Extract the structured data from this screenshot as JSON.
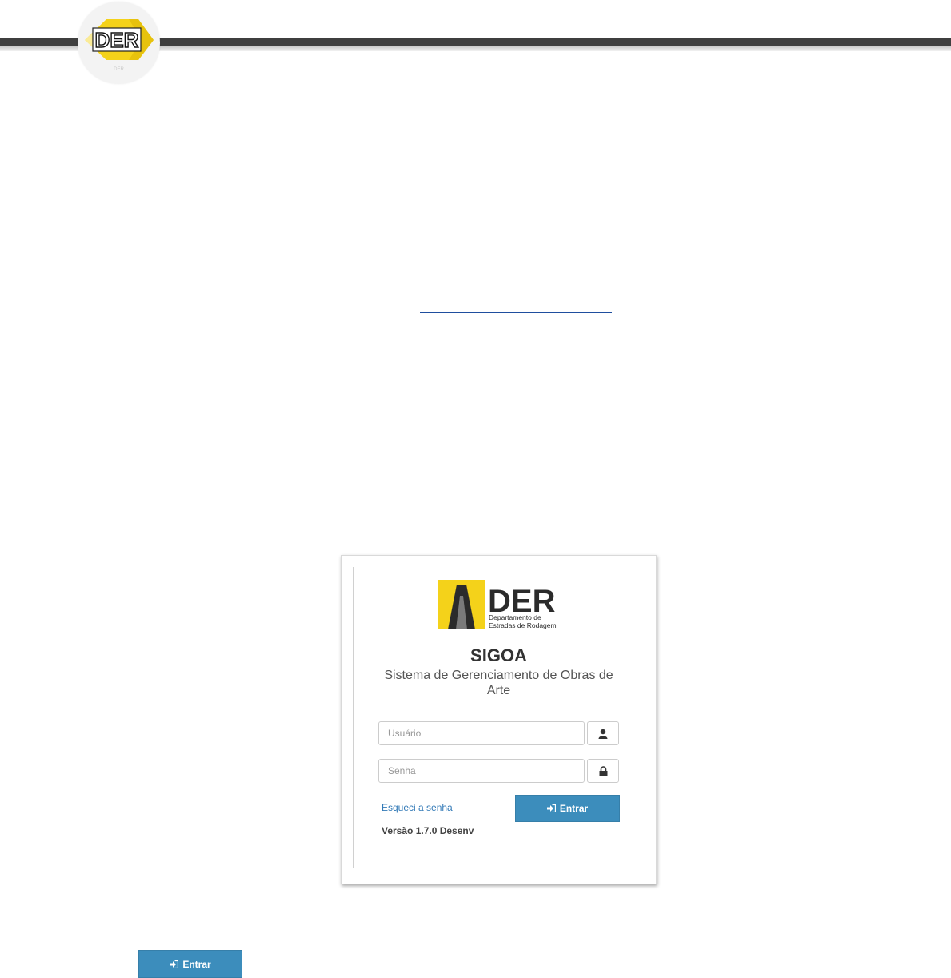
{
  "header": {
    "logo_text": "DER",
    "logo_small_text": "DER"
  },
  "login": {
    "logo": {
      "brand": "DER",
      "line1": "Departamento de",
      "line2": "Estradas de Rodagem"
    },
    "title": "SIGOA",
    "subtitle": "Sistema de Gerenciamento de Obras de Arte",
    "username_placeholder": "Usuário",
    "password_placeholder": "Senha",
    "forgot_label": "Esqueci a senha",
    "submit_label": "Entrar",
    "version": "Versão 1.7.0 Desenv"
  },
  "standalone_button": {
    "label": "Entrar"
  },
  "colors": {
    "accent": "#3c8dbc",
    "link": "#337ab7",
    "brand_yellow": "#f4d21a",
    "header_bar": "#3f3f3f"
  }
}
